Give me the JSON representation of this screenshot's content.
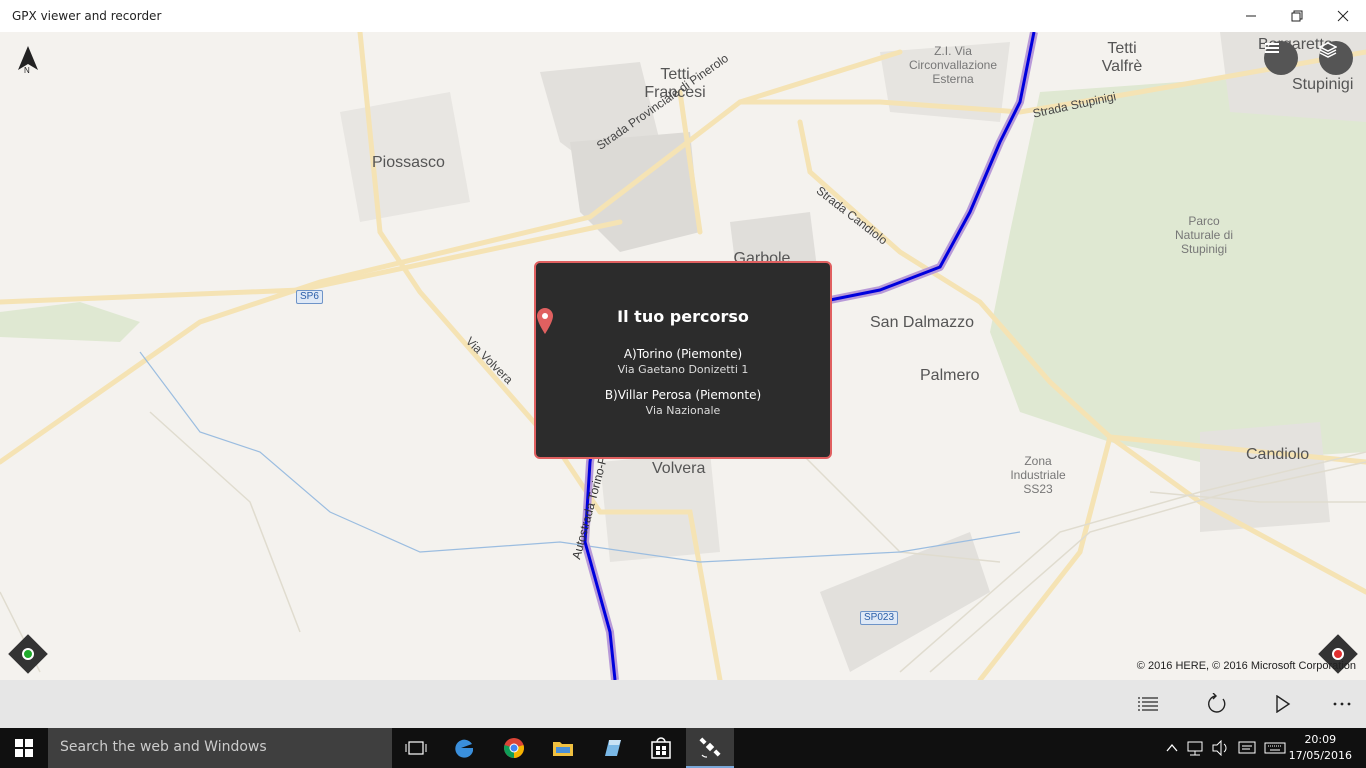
{
  "window": {
    "title": "GPX viewer and recorder"
  },
  "map": {
    "towns": [
      "Tetti Francesi",
      "Tetti Valfrè",
      "Borgaretto",
      "Stupinigi",
      "Piossasco",
      "Garbole Zucche",
      "San Dalmazzo",
      "Palmero",
      "Volvera",
      "Candiolo"
    ],
    "small_labels": [
      "Z.I. Via Circonvallazione Esterna",
      "Parco Naturale di Stupinigi",
      "Zona Industriale SS23"
    ],
    "roads": [
      "Strada Stupinigi",
      "Strada Provinciale di Pinerolo",
      "Strada Candiolo",
      "Via Volvera",
      "Autostrada Torino-Pinerolo"
    ],
    "shields": [
      "SP6",
      "SP023"
    ],
    "copyright": "© 2016 HERE, © 2016 Microsoft Corporation",
    "compass_label": "N"
  },
  "popup": {
    "title": "Il tuo percorso",
    "a_label": "A)Torino (Piemonte)",
    "a_address": "Via Gaetano Donizetti 1",
    "b_label": "B)Villar Perosa (Piemonte)",
    "b_address": "Via Nazionale"
  },
  "taskbar": {
    "search_placeholder": "Search the web and Windows",
    "time": "20:09",
    "date": "17/05/2016"
  },
  "colors": {
    "route": "#0000dd",
    "popup_border": "#e06060",
    "start_dot": "#1faa2a",
    "record_dot": "#e03030"
  }
}
